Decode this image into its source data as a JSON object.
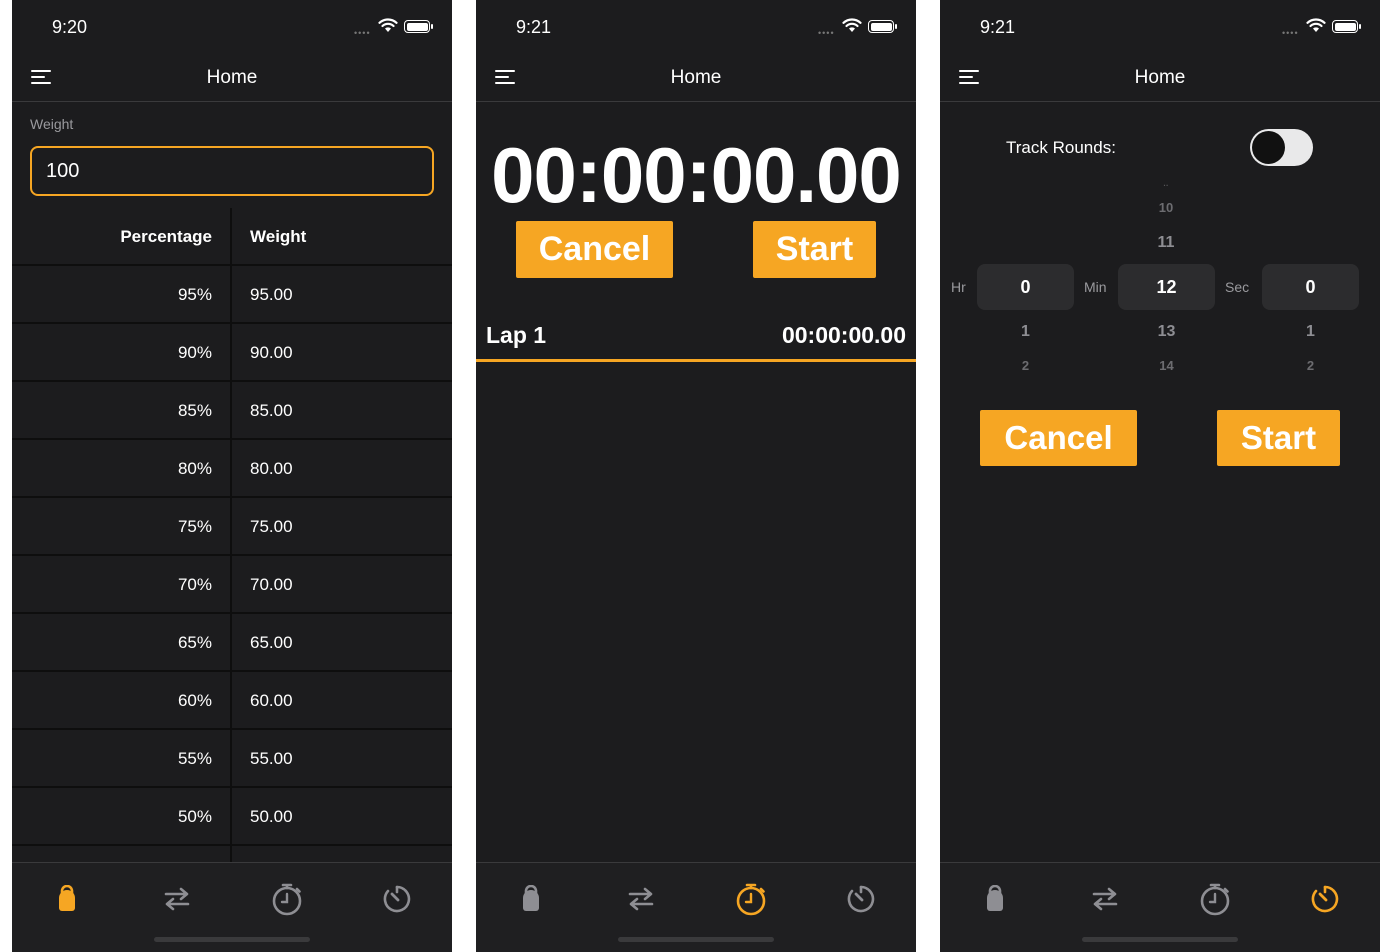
{
  "screens": [
    {
      "time": "9:20",
      "nav_title": "Home",
      "weight_label": "Weight",
      "weight_value": "100",
      "table_headers": [
        "Percentage",
        "Weight"
      ],
      "rows": [
        {
          "pct": "95%",
          "weight": "95.00"
        },
        {
          "pct": "90%",
          "weight": "90.00"
        },
        {
          "pct": "85%",
          "weight": "85.00"
        },
        {
          "pct": "80%",
          "weight": "80.00"
        },
        {
          "pct": "75%",
          "weight": "75.00"
        },
        {
          "pct": "70%",
          "weight": "70.00"
        },
        {
          "pct": "65%",
          "weight": "65.00"
        },
        {
          "pct": "60%",
          "weight": "60.00"
        },
        {
          "pct": "55%",
          "weight": "55.00"
        },
        {
          "pct": "50%",
          "weight": "50.00"
        }
      ],
      "active_tab": "kettlebell"
    },
    {
      "time": "9:21",
      "nav_title": "Home",
      "stopwatch": "00:00:00.00",
      "cancel_label": "Cancel",
      "start_label": "Start",
      "lap_label": "Lap 1",
      "lap_time": "00:00:00.00",
      "active_tab": "stopwatch"
    },
    {
      "time": "9:21",
      "nav_title": "Home",
      "track_rounds_label": "Track Rounds:",
      "track_rounds_on": false,
      "picker_labels": {
        "hr": "Hr",
        "min": "Min",
        "sec": "Sec"
      },
      "picker_selected": {
        "hr": "0",
        "min": "12",
        "sec": "0"
      },
      "picker_above": {
        "min": [
          "10",
          "11"
        ]
      },
      "picker_below": {
        "hr": [
          "1",
          "2"
        ],
        "min": [
          "13",
          "14"
        ],
        "sec": [
          "1",
          "2"
        ]
      },
      "cancel_label": "Cancel",
      "start_label": "Start",
      "active_tab": "timer"
    }
  ],
  "tabs": [
    "kettlebell-icon",
    "swap-arrows-icon",
    "stopwatch-icon",
    "timer-icon"
  ],
  "colors": {
    "accent": "#f6a623",
    "background": "#1c1c1e",
    "inactive_icon": "#8e8e93"
  }
}
